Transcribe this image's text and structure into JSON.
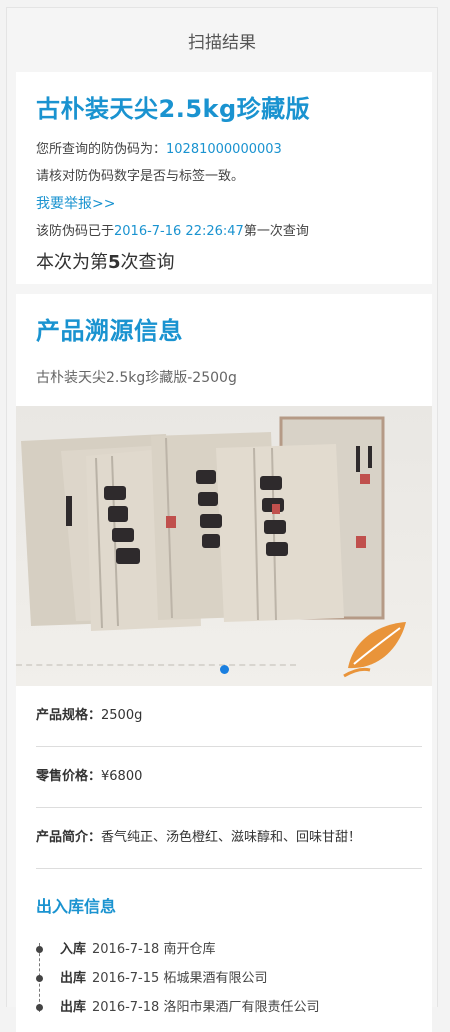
{
  "header": {
    "title": "扫描结果"
  },
  "verify": {
    "product_title": "古朴装天尖2.5kg珍藏版",
    "code_prefix": "您所查询的防伪码为：",
    "code": "10281000000003",
    "check_text": "请核对防伪码数字是否与标签一致。",
    "report_link": "我要举报>>",
    "first_prefix": "该防伪码已于",
    "first_time": "2016-7-16 22:26:47",
    "first_suffix": "第一次查询",
    "count_prefix": "本次为第",
    "count_num": "5",
    "count_suffix": "次查询"
  },
  "trace": {
    "title": "产品溯源信息",
    "subtitle": "古朴装天尖2.5kg珍藏版-2500g",
    "spec_key": "产品规格：",
    "spec_val": "2500g",
    "price_key": "零售价格：",
    "price_val": "¥6800",
    "intro_key": "产品简介：",
    "intro_val": "香气纯正、汤色橙红、滋味醇和、回味甘甜！",
    "warehouse_title": "出入库信息",
    "records": [
      {
        "type": "入库",
        "date": "2016-7-18",
        "place": "南开仓库"
      },
      {
        "type": "出库",
        "date": "2016-7-15",
        "place": "柘城果酒有限公司"
      },
      {
        "type": "出库",
        "date": "2016-7-18",
        "place": "洛阳市果酒厂有限责任公司"
      }
    ]
  },
  "banner": {
    "image": "tea-packages-image",
    "slides_dot": "active-slide-dot"
  }
}
